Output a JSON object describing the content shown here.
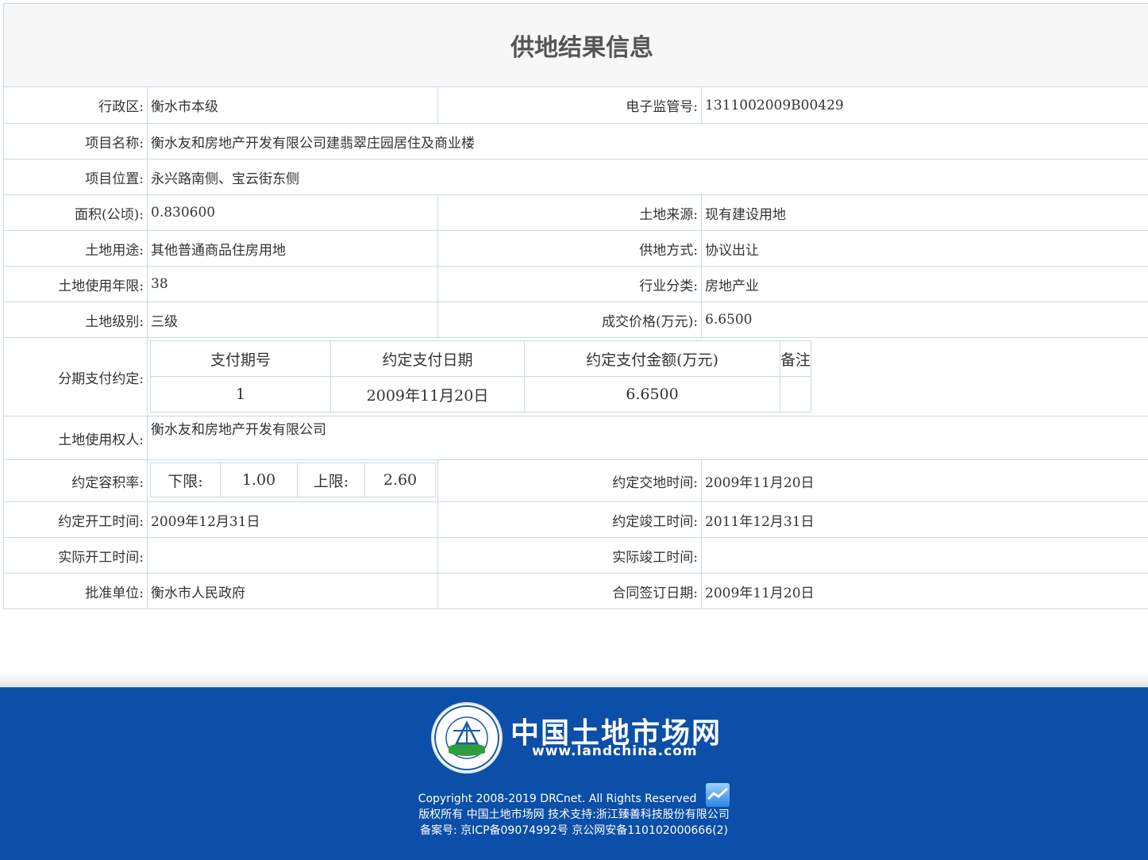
{
  "page": {
    "title": "供地结果信息"
  },
  "fields": {
    "district_label": "行政区:",
    "district_value": "衡水市本级",
    "supervision_no_label": "电子监管号:",
    "supervision_no_value": "1311002009B00429",
    "project_name_label": "项目名称:",
    "project_name_value": "衡水友和房地产开发有限公司建翡翠庄园居住及商业楼",
    "project_location_label": "项目位置:",
    "project_location_value": "永兴路南侧、宝云街东侧",
    "area_label": "面积(公顷):",
    "area_value": "0.830600",
    "land_source_label": "土地来源:",
    "land_source_value": "现有建设用地",
    "land_use_label": "土地用途:",
    "land_use_value": "其他普通商品住房用地",
    "supply_method_label": "供地方式:",
    "supply_method_value": "协议出让",
    "use_years_label": "土地使用年限:",
    "use_years_value": "38",
    "industry_label": "行业分类:",
    "industry_value": "房地产业",
    "land_grade_label": "土地级别:",
    "land_grade_value": "三级",
    "price_label": "成交价格(万元):",
    "price_value": "6.6500",
    "installment_label": "分期支付约定:",
    "installment_headers": [
      "支付期号",
      "约定支付日期",
      "约定支付金额(万元)",
      "备注"
    ],
    "installment_rows": [
      {
        "no": "1",
        "date": "2009年11月20日",
        "amount": "6.6500",
        "note": ""
      }
    ],
    "land_user_label": "土地使用权人:",
    "land_user_value": "衡水友和房地产开发有限公司",
    "far_label": "约定容积率:",
    "far_lower_label": "下限:",
    "far_lower_value": "1.00",
    "far_upper_label": "上限:",
    "far_upper_value": "2.60",
    "handover_label": "约定交地时间:",
    "handover_value": "2009年11月20日",
    "start_label": "约定开工时间:",
    "start_value": "2009年12月31日",
    "completion_label": "约定竣工时间:",
    "completion_value": "2011年12月31日",
    "actual_start_label": "实际开工时间:",
    "actual_start_value": "",
    "actual_completion_label": "实际竣工时间:",
    "actual_completion_value": "",
    "approver_label": "批准单位:",
    "approver_value": "衡水市人民政府",
    "contract_date_label": "合同签订日期:",
    "contract_date_value": "2009年11月20日"
  },
  "footer": {
    "logo_name": "中国土地市场网",
    "logo_url": "www.landchina.com",
    "copyright": "Copyright 2008-2019 DRCnet. All Rights Reserved",
    "rights": "版权所有  中国土地市场网  技术支持:浙江臻善科技股份有限公司",
    "icp": "备案号: 京ICP备09074992号 京公网安备110102000666(2)",
    "icon": "stats-chart-icon"
  },
  "colors": {
    "border": "#c9d9e6",
    "footer_bg": "#0b4fa8",
    "title_bg": "#f7f7f7"
  }
}
